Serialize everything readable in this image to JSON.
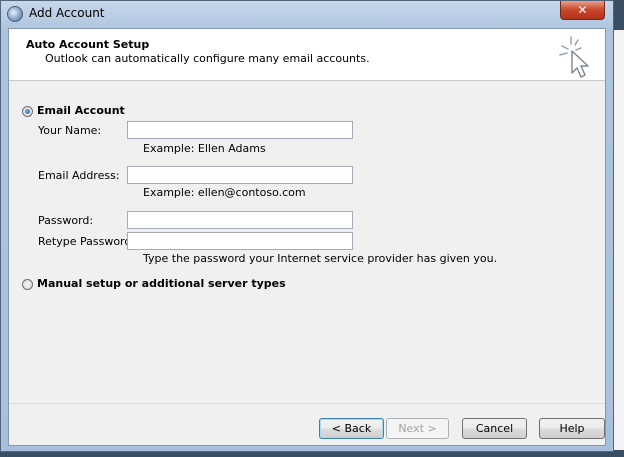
{
  "window": {
    "title": "Add Account",
    "close_glyph": "✕",
    "icon": "outlook-app-icon"
  },
  "header": {
    "title": "Auto Account Setup",
    "subtitle": "Outlook can automatically configure many email accounts.",
    "icon": "wizard-sparkle-cursor-icon"
  },
  "email_account": {
    "label": "Email Account",
    "selected": true,
    "fields": {
      "your_name_label": "Your Name:",
      "your_name_value": "",
      "your_name_hint": "Example: Ellen Adams",
      "email_label": "Email Address:",
      "email_value": "",
      "email_hint": "Example: ellen@contoso.com",
      "password_label": "Password:",
      "password_value": "",
      "retype_label": "Retype Password:",
      "retype_value": "",
      "password_hint": "Type the password your Internet service provider has given you."
    }
  },
  "manual_setup": {
    "label": "Manual setup or additional server types",
    "selected": false
  },
  "buttons": {
    "back": "< Back",
    "next": "Next >",
    "cancel": "Cancel",
    "help": "Help"
  },
  "colors": {
    "client_bg": "#f0f0f0",
    "header_bg": "#ffffff",
    "close_button": "#c9462a"
  }
}
